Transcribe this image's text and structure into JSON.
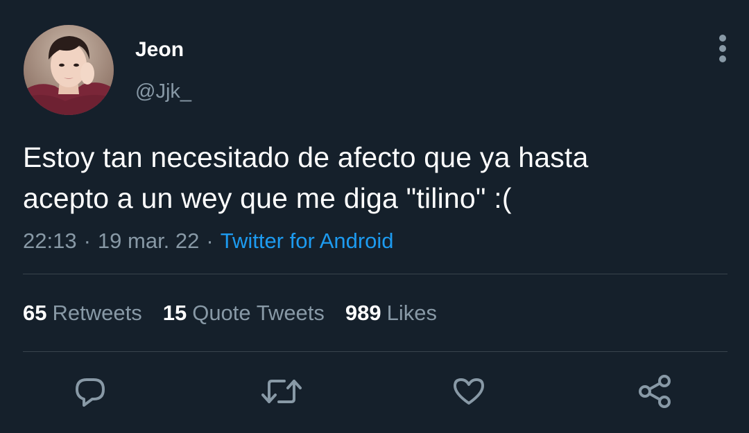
{
  "user": {
    "display_name": "Jeon",
    "handle": "@Jjk_"
  },
  "tweet": {
    "text_lines": [
      "Estoy tan necesitado de afecto que ya hasta",
      "acepto a un wey que me diga \"tilino\" :("
    ],
    "time": "22:13",
    "separator": "·",
    "date": "19 mar. 22",
    "source": "Twitter for Android"
  },
  "stats": {
    "retweets": {
      "count": "65",
      "label": "Retweets"
    },
    "quote_tweets": {
      "count": "15",
      "label": "Quote Tweets"
    },
    "likes": {
      "count": "989",
      "label": "Likes"
    }
  },
  "actions": [
    {
      "name": "reply",
      "icon": "reply-icon"
    },
    {
      "name": "retweet",
      "icon": "retweet-icon"
    },
    {
      "name": "like",
      "icon": "heart-icon"
    },
    {
      "name": "share",
      "icon": "share-icon"
    }
  ],
  "colors": {
    "background": "#15202b",
    "secondary_text": "#8899a6",
    "link": "#1d9bf0",
    "divider": "#38444d"
  }
}
